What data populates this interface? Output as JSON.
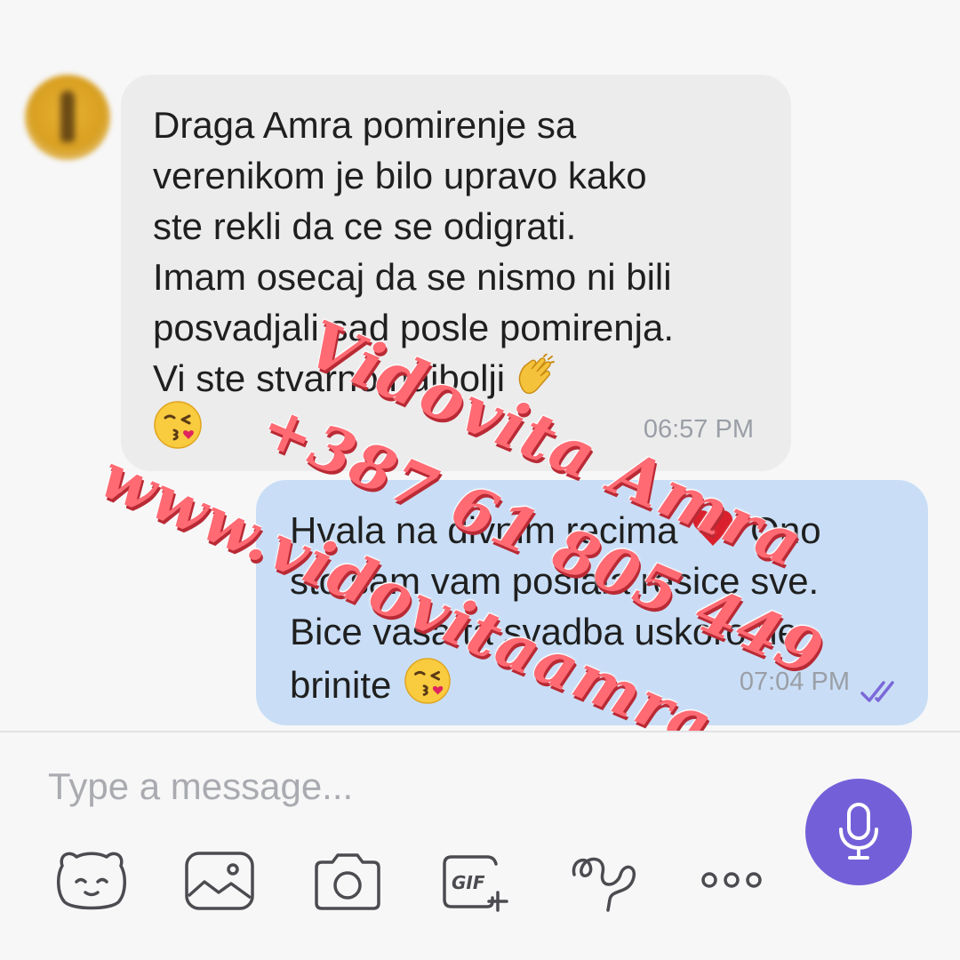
{
  "messages": [
    {
      "direction": "incoming",
      "text": "Draga Amra pomirenje sa\nverenikom je bilo upravo kako\nste rekli da ce se odigrati.\nImam osecaj da se nismo ni bili\nposvadjali sad posle pomirenja.\nVi ste stvarno najbolji",
      "emoji_inline": "clapping-hands-emoji",
      "emoji_bottom": "kissing-face-emoji",
      "time": "06:57 PM"
    },
    {
      "direction": "outgoing",
      "text_part1": "Hvala na divnim recima",
      "text_part2": " Ono\nsto sam vam poslala resice sve.\nBice vasa ta svadba uskoro ne\nbrinite",
      "emoji_heart": "red-heart-emoji",
      "emoji_end": "kissing-face-emoji",
      "time": "07:04 PM",
      "status": "read-double-check"
    }
  ],
  "composer": {
    "placeholder": "Type a message..."
  },
  "toolbar": [
    "sticker-bear-icon",
    "gallery-icon",
    "camera-icon",
    "gif-icon",
    "doodle-icon",
    "more-icon"
  ],
  "watermark": {
    "line1": "Vidovita Amra",
    "line2": "+387 61 805 449",
    "line3": "www.vidovitaamra.com"
  },
  "colors": {
    "incoming_bubble": "#ececec",
    "outgoing_bubble": "#c9def6",
    "accent": "#7360d8",
    "watermark": "#ff6a73"
  }
}
